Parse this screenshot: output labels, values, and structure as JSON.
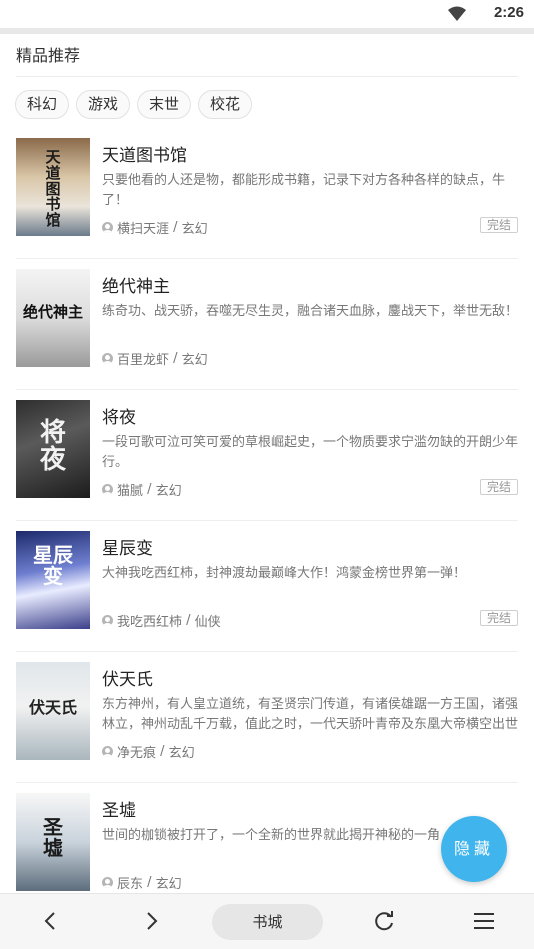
{
  "status_bar": {
    "time": "2:26"
  },
  "section": {
    "title": "精品推荐"
  },
  "tags": [
    "科幻",
    "游戏",
    "末世",
    "校花"
  ],
  "books": [
    {
      "title": "天道图书馆",
      "cover_text": "天道图书馆",
      "description": "只要他看的人还是物，都能形成书籍，记录下对方各种各样的缺点，牛了！",
      "author": "横扫天涯",
      "genre": "玄幻",
      "status": "完结"
    },
    {
      "title": "绝代神主",
      "cover_text": "绝代神主",
      "description": "练奇功、战天骄，吞噬无尽生灵，融合诸天血脉，鏖战天下，举世无敌！",
      "author": "百里龙虾",
      "genre": "玄幻",
      "status": ""
    },
    {
      "title": "将夜",
      "cover_text": "将夜",
      "description": "一段可歌可泣可笑可爱的草根崛起史，一个物质要求宁滥勿缺的开朗少年行。",
      "author": "猫腻",
      "genre": "玄幻",
      "status": "完结"
    },
    {
      "title": "星辰变",
      "cover_text": "星辰变",
      "description": "大神我吃西红柿，封神渡劫最巅峰大作！鸿蒙金榜世界第一弹！",
      "author": "我吃西红柿",
      "genre": "仙侠",
      "status": "完结"
    },
    {
      "title": "伏天氏",
      "cover_text": "伏天氏",
      "description": "东方神州，有人皇立道统，有圣贤宗门传道，有诸侯雄踞一方王国，诸强林立，神州动乱千万载，值此之时，一代天骄叶青帝及东凰大帝横空出世",
      "author": "净无痕",
      "genre": "玄幻",
      "status": ""
    },
    {
      "title": "圣墟",
      "cover_text": "圣墟",
      "description": "世间的枷锁被打开了，一个全新的世界就此揭开神秘的一角",
      "author": "辰东",
      "genre": "玄幻",
      "status": ""
    }
  ],
  "fab": {
    "label": "隐藏"
  },
  "bottom_bar": {
    "home_label": "书城"
  },
  "colors": {
    "accent": "#40b4ec",
    "divider": "#eeeeee",
    "text_secondary": "#777777"
  },
  "icons": [
    "wifi-icon",
    "user-icon",
    "back-arrow-icon",
    "forward-arrow-icon",
    "refresh-icon",
    "menu-icon"
  ]
}
